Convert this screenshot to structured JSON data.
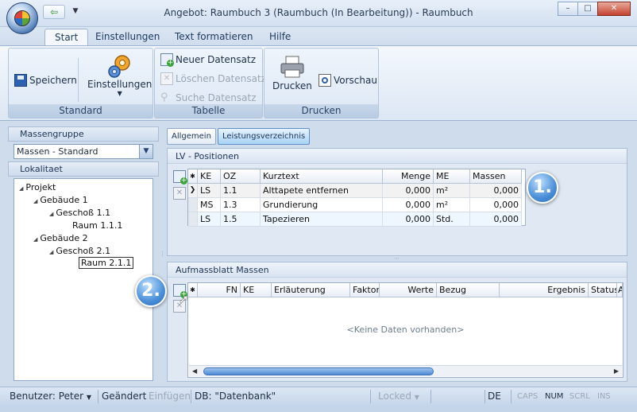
{
  "window": {
    "title": "Angebot: Raumbuch 3  (Raumbuch  (In Bearbeitung)) - Raumbuch",
    "controls": [
      "–",
      "□",
      "✕"
    ]
  },
  "ribbon_tabs": [
    "Start",
    "Einstellungen",
    "Text formatieren",
    "Hilfe"
  ],
  "ribbon": {
    "standard": {
      "label": "Standard",
      "save": "Speichern",
      "settings": "Einstellungen"
    },
    "tabelle": {
      "label": "Tabelle",
      "new": "Neuer Datensatz",
      "delete": "Löschen Datensatz",
      "search": "Suche Datensatz"
    },
    "drucken": {
      "label": "Drucken",
      "print": "Drucken",
      "preview": "Vorschau"
    }
  },
  "left_panel": {
    "massengruppe_label": "Massengruppe",
    "massengruppe_value": "Massen - Standard",
    "lokalitaet_label": "Lokalitaet",
    "tree": [
      "Projekt",
      "Gebäude 1",
      "Geschoß 1.1",
      "Raum 1.1.1",
      "Gebäude 2",
      "Geschoß 2.1",
      "Raum 2.1.1"
    ]
  },
  "right_tabs": [
    "Allgemein",
    "Leistungsverzeichnis"
  ],
  "lv": {
    "title": "LV - Positionen",
    "columns": [
      "KE",
      "OZ",
      "Kurztext",
      "Menge",
      "ME",
      "Massen"
    ],
    "rows": [
      [
        "LS",
        "1.1",
        "Alttapete entfernen",
        "0,000",
        "m²",
        "0,000"
      ],
      [
        "MS",
        "1.3",
        "Grundierung",
        "0,000",
        "m²",
        "0,000"
      ],
      [
        "LS",
        "1.5",
        "Tapezieren",
        "0,000",
        "Std.",
        "0,000"
      ]
    ]
  },
  "aufmass": {
    "title": "Aufmassblatt Massen",
    "columns": [
      "FN",
      "KE",
      "Erläuterung",
      "Faktor",
      "Werte",
      "Bezug",
      "Ergebnis",
      "Status",
      "A"
    ],
    "empty": "<Keine Daten vorhanden>"
  },
  "callouts": [
    "1.",
    "2."
  ],
  "statusbar": {
    "user": "Benutzer: Peter",
    "changed": "Geändert",
    "insert": "Einfügen",
    "db": "DB: \"Datenbank\"",
    "locked": "Locked",
    "lang": "DE",
    "caps": "CAPS",
    "num": "NUM",
    "scrl": "SCRL",
    "ins": "INS"
  }
}
